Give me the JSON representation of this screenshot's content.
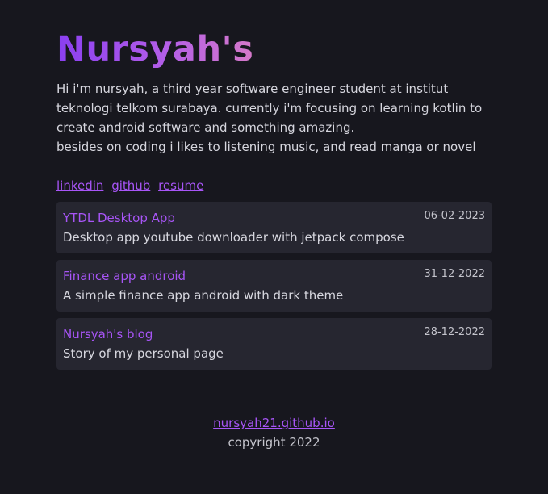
{
  "header": {
    "title": "Nursyah's"
  },
  "bio": {
    "line1": "Hi i'm nursyah, a third year software engineer student at institut teknologi telkom surabaya. currently i'm focusing on learning kotlin to create android software and something amazing.",
    "line2": "besides on coding i likes to listening music, and read manga or novel"
  },
  "links": [
    {
      "label": "linkedin"
    },
    {
      "label": "github"
    },
    {
      "label": "resume"
    }
  ],
  "projects": [
    {
      "title": "YTDL Desktop App",
      "description": "Desktop app youtube downloader with jetpack compose",
      "date": "06-02-2023"
    },
    {
      "title": "Finance app android",
      "description": "A simple finance app android with dark theme",
      "date": "31-12-2022"
    },
    {
      "title": "Nursyah's blog",
      "description": "Story of my personal page",
      "date": "28-12-2022"
    }
  ],
  "footer": {
    "site_link": "nursyah21.github.io",
    "copyright": "copyright 2022"
  },
  "colors": {
    "background": "#17171e",
    "card": "#262630",
    "accent": "#a855f7",
    "text": "#d6d6de"
  }
}
